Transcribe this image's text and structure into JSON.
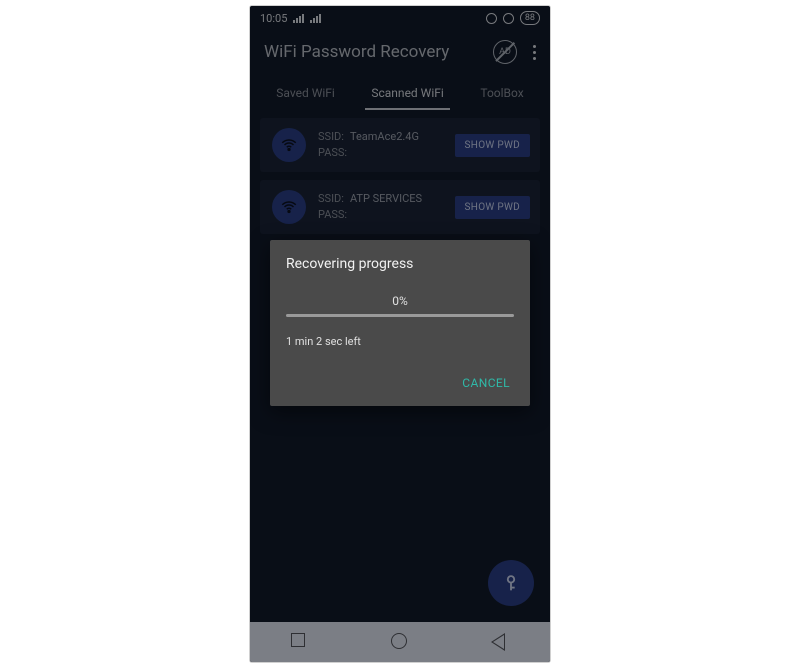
{
  "status": {
    "time": "10:05",
    "battery": "88"
  },
  "app": {
    "title": "WiFi Password Recovery",
    "ad_label": "AD"
  },
  "tabs": [
    {
      "label": "Saved WiFi"
    },
    {
      "label": "Scanned WiFi"
    },
    {
      "label": "ToolBox"
    }
  ],
  "active_tab_index": 1,
  "fields": {
    "ssid_label": "SSID:",
    "pass_label": "PASS:",
    "show_button": "SHOW PWD"
  },
  "networks": [
    {
      "ssid": "TeamAce2.4G",
      "pass": ""
    },
    {
      "ssid": "ATP SERVICES",
      "pass": ""
    }
  ],
  "dialog": {
    "title": "Recovering progress",
    "percent_text": "0%",
    "percent_value": 0,
    "eta": "1 min 2 sec left",
    "cancel": "CANCEL"
  },
  "colors": {
    "accent": "#2a3f87",
    "teal": "#2fb9a8",
    "surface": "#1a2438",
    "dialog": "#4a4a4a"
  }
}
